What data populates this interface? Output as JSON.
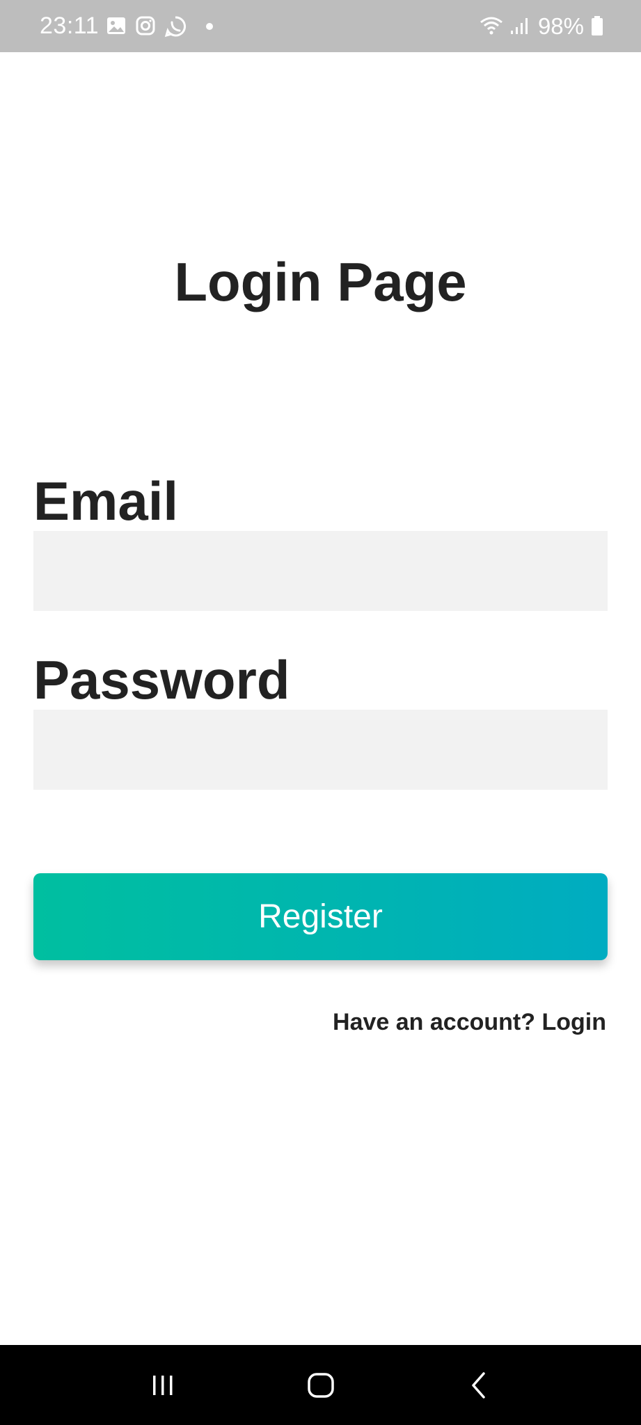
{
  "status_bar": {
    "time": "23:11",
    "battery": "98%",
    "icons": [
      "gallery-icon",
      "instagram-icon",
      "whatsapp-icon",
      "dot-icon",
      "wifi-icon",
      "signal-icon",
      "battery-icon"
    ]
  },
  "page": {
    "title": "Login Page"
  },
  "form": {
    "email_label": "Email",
    "email_value": "",
    "password_label": "Password",
    "password_value": "",
    "register_label": "Register",
    "account_link": "Have an account? Login"
  },
  "nav_bar": {
    "icons": [
      "recents-icon",
      "home-icon",
      "back-icon"
    ]
  },
  "colors": {
    "status_bar": "#bdbdbd",
    "button_gradient_start": "#00bfa0",
    "button_gradient_end": "#00acc1",
    "input_background": "#f2f2f2",
    "text": "#222222"
  }
}
